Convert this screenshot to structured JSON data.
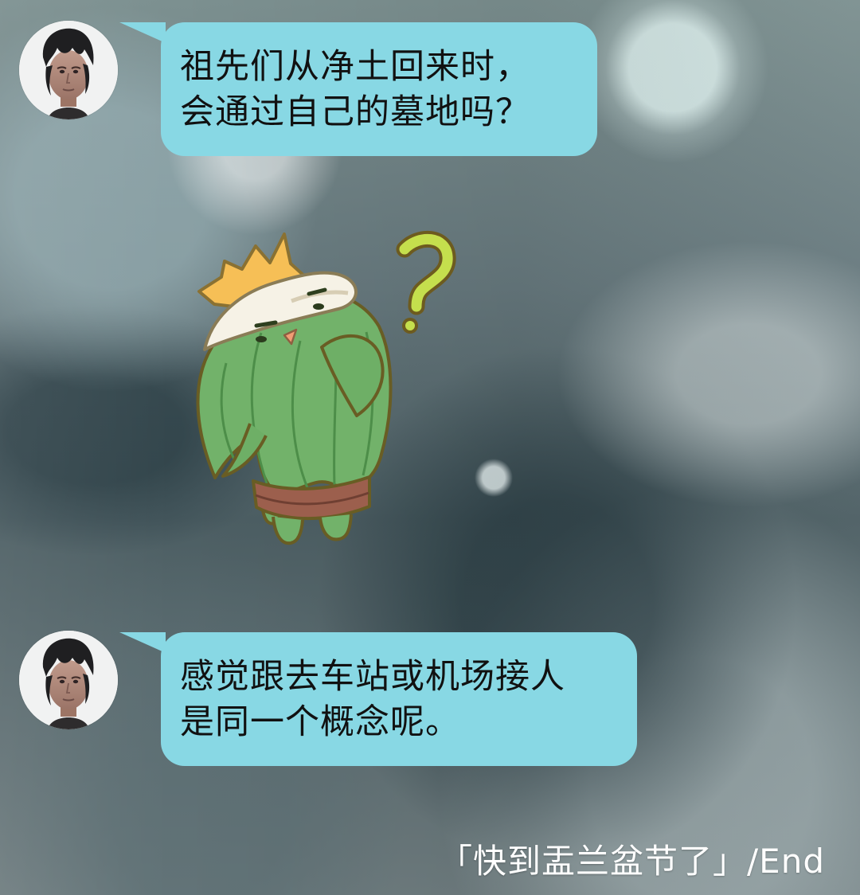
{
  "messages": [
    {
      "line1": "祖先们从净土回来时，",
      "line2": "会通过自己的墓地吗？"
    },
    {
      "line1": "感觉跟去车站或机场接人",
      "line2": "是同一个概念呢。"
    }
  ],
  "sticker": {
    "character": "cactus",
    "symbol": "?"
  },
  "footer": {
    "caption": "「快到盂兰盆节了」/End"
  },
  "colors": {
    "bubble": "#88d8e4",
    "cactus": "#71b26a",
    "question_mark": "#c6e04c"
  }
}
